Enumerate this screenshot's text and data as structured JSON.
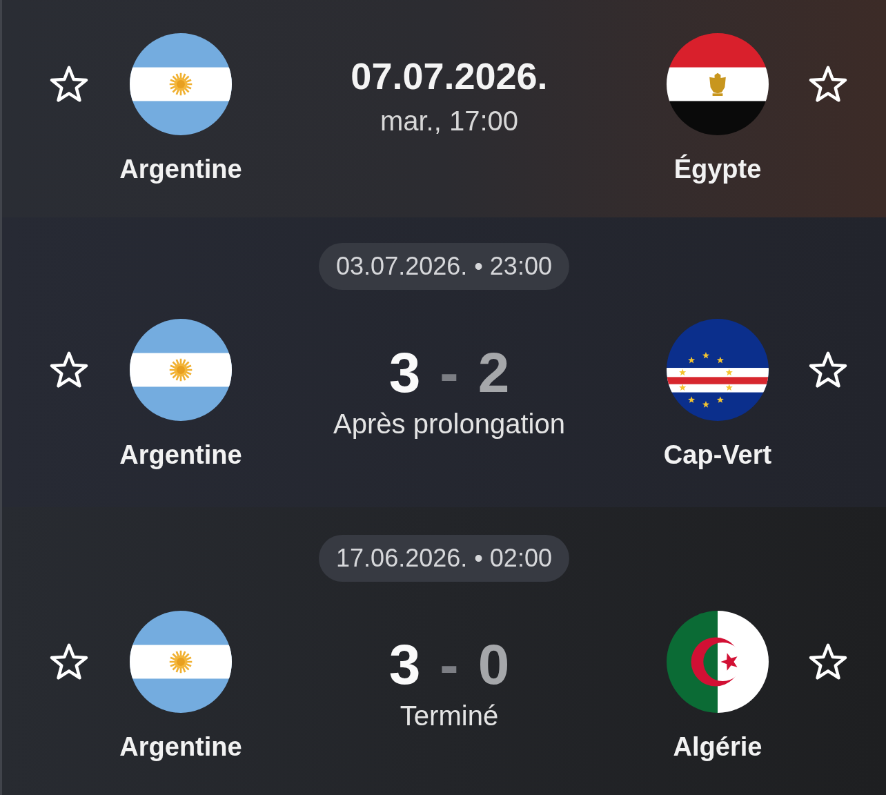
{
  "matches": [
    {
      "kind": "upcoming",
      "date": "07.07.2026.",
      "time": "mar., 17:00",
      "teams": [
        {
          "name": "Argentine",
          "kind": "argentina",
          "favorite": false
        },
        {
          "name": "Égypte",
          "kind": "egypt",
          "favorite": false
        }
      ]
    },
    {
      "kind": "result",
      "datetime": "03.07.2026. • 23:00",
      "separator": "-",
      "status": "Après prolongation",
      "teams": [
        {
          "name": "Argentine",
          "kind": "argentina",
          "favorite": false,
          "score": "3",
          "winner": true
        },
        {
          "name": "Cap-Vert",
          "kind": "cape_verde",
          "favorite": false,
          "score": "2",
          "winner": false
        }
      ]
    },
    {
      "kind": "result",
      "datetime": "17.06.2026. • 02:00",
      "separator": "-",
      "status": "Terminé",
      "teams": [
        {
          "name": "Argentine",
          "kind": "argentina",
          "favorite": false,
          "score": "3",
          "winner": true
        },
        {
          "name": "Algérie",
          "kind": "algeria",
          "favorite": false,
          "score": "0",
          "winner": false
        }
      ]
    }
  ]
}
